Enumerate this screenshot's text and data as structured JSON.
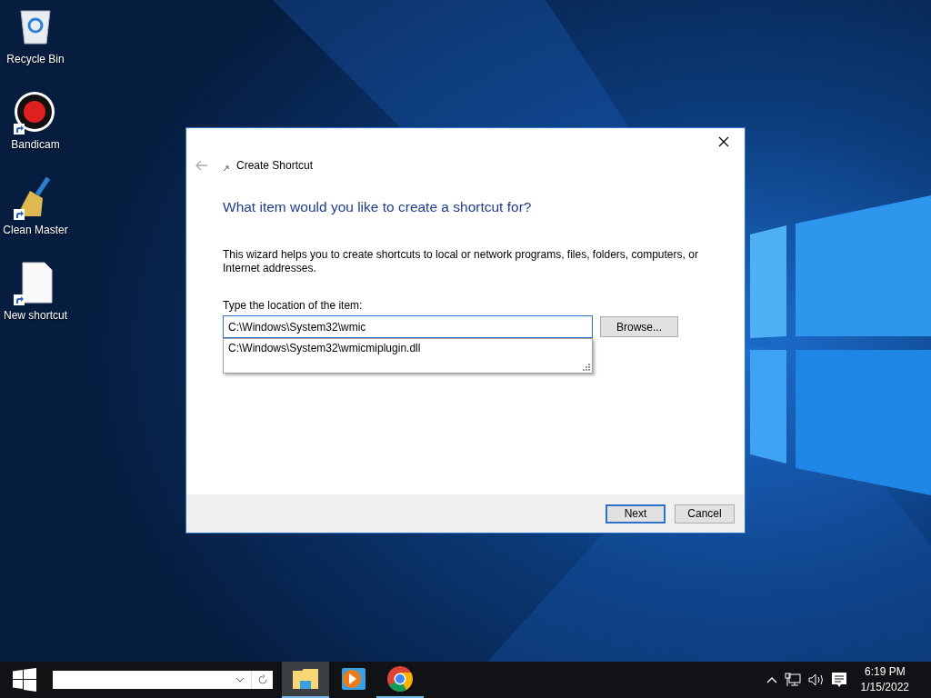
{
  "desktop_icons": [
    {
      "label": "Recycle Bin",
      "kind": "recycle",
      "shortcut": false
    },
    {
      "label": "Bandicam",
      "kind": "record",
      "shortcut": true
    },
    {
      "label": "Clean Master",
      "kind": "broom",
      "shortcut": true
    },
    {
      "label": "New shortcut",
      "kind": "file",
      "shortcut": true
    }
  ],
  "dialog": {
    "title": "Create Shortcut",
    "heading": "What item would you like to create a shortcut for?",
    "description": "This wizard helps you to create shortcuts to local or network programs, files, folders, computers, or Internet addresses.",
    "field_label": "Type the location of the item:",
    "location_value": "C:\\Windows\\System32\\wmic",
    "browse_label": "Browse...",
    "suggestions": [
      "C:\\Windows\\System32\\wmicmiplugin.dll"
    ],
    "footer_buttons": [
      {
        "label": "Next",
        "default": true
      },
      {
        "label": "Cancel",
        "default": false
      }
    ]
  },
  "taskbar": {
    "apps": [
      {
        "kind": "folder",
        "selected": true,
        "open": true
      },
      {
        "kind": "player",
        "selected": false,
        "open": false
      },
      {
        "kind": "browser",
        "selected": false,
        "open": true
      }
    ],
    "time": "6:19 PM",
    "date": "1/15/2022"
  }
}
